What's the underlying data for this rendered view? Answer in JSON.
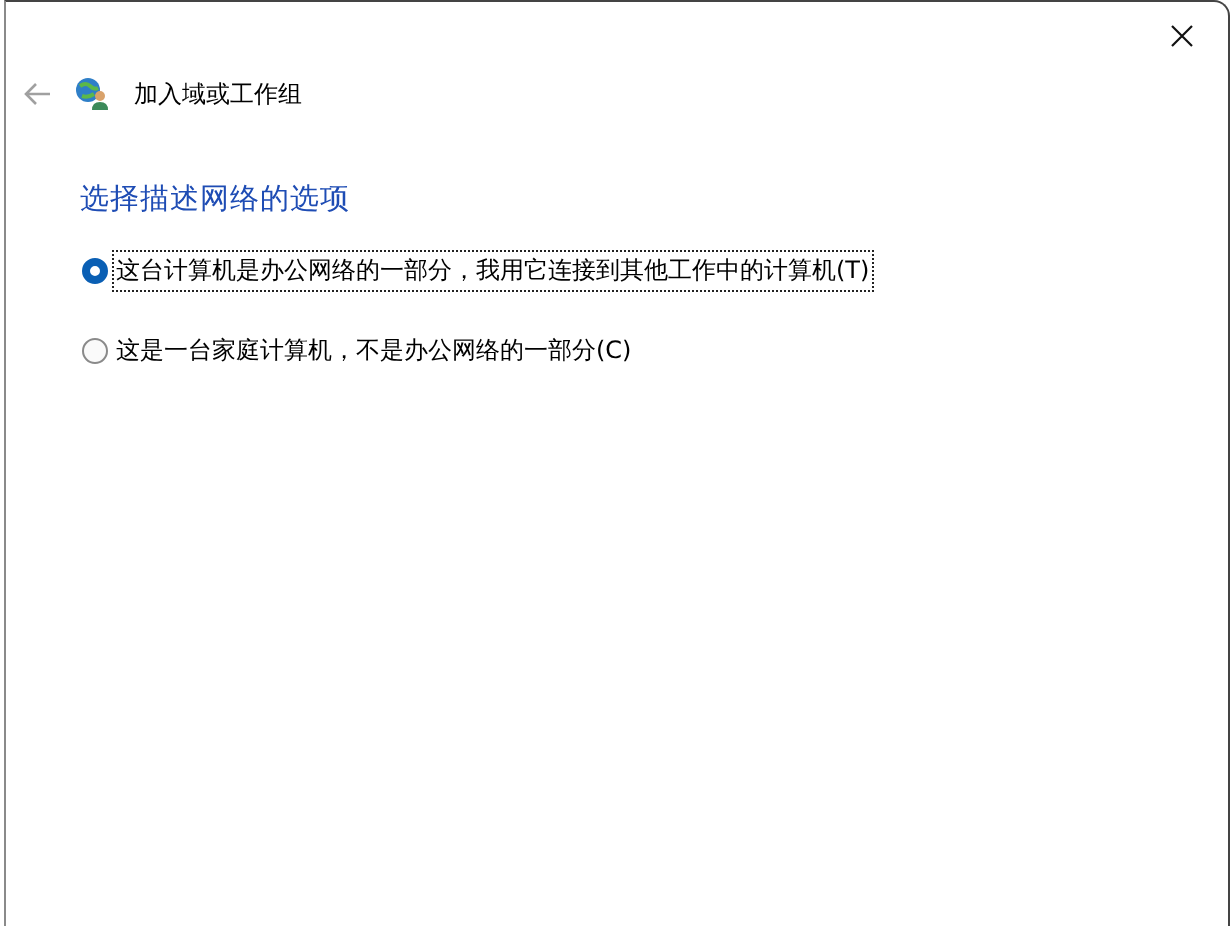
{
  "window": {
    "title": "加入域或工作组"
  },
  "back_button": {
    "disabled": true
  },
  "heading": "选择描述网络的选项",
  "options": [
    {
      "label": "这台计算机是办公网络的一部分，我用它连接到其他工作中的计算机(T)",
      "selected": true,
      "focused": true
    },
    {
      "label": "这是一台家庭计算机，不是办公网络的一部分(C)",
      "selected": false,
      "focused": false
    }
  ]
}
